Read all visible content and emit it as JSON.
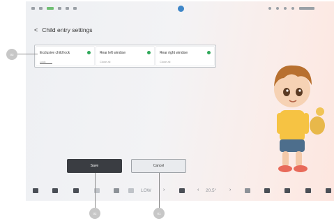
{
  "status_bar": {
    "left_text": "",
    "right_text": ""
  },
  "header": {
    "back_symbol": "<",
    "title": "Child entry settings"
  },
  "options": [
    {
      "title": "Exclusive child lock",
      "subtitle": "Lock",
      "status_color": "#2fa85a"
    },
    {
      "title": "Rear left window",
      "subtitle": "Close all",
      "status_color": "#2fa85a"
    },
    {
      "title": "Rear right window",
      "subtitle": "Close all",
      "status_color": "#2fa85a"
    }
  ],
  "buttons": {
    "save_label": "Save",
    "cancel_label": "Cancel"
  },
  "dock": {
    "fan_speed": "LOW",
    "temperature": "20.5°",
    "left_arrow": "‹",
    "right_arrow": "›",
    "icons": [
      "home-icon",
      "car-icon",
      "seat-icon",
      "vehicle-icon",
      "phone-icon",
      "fan-icon",
      "seat-heat-icon",
      "wiper-icon",
      "media-icon",
      "music-icon",
      "apps-icon",
      "volume-icon"
    ]
  },
  "callouts": [
    "03",
    "02",
    "01"
  ],
  "colors": {
    "accent_green": "#2fa85a",
    "save_bg": "#3a3d42",
    "cancel_bg": "#e9ebee"
  }
}
